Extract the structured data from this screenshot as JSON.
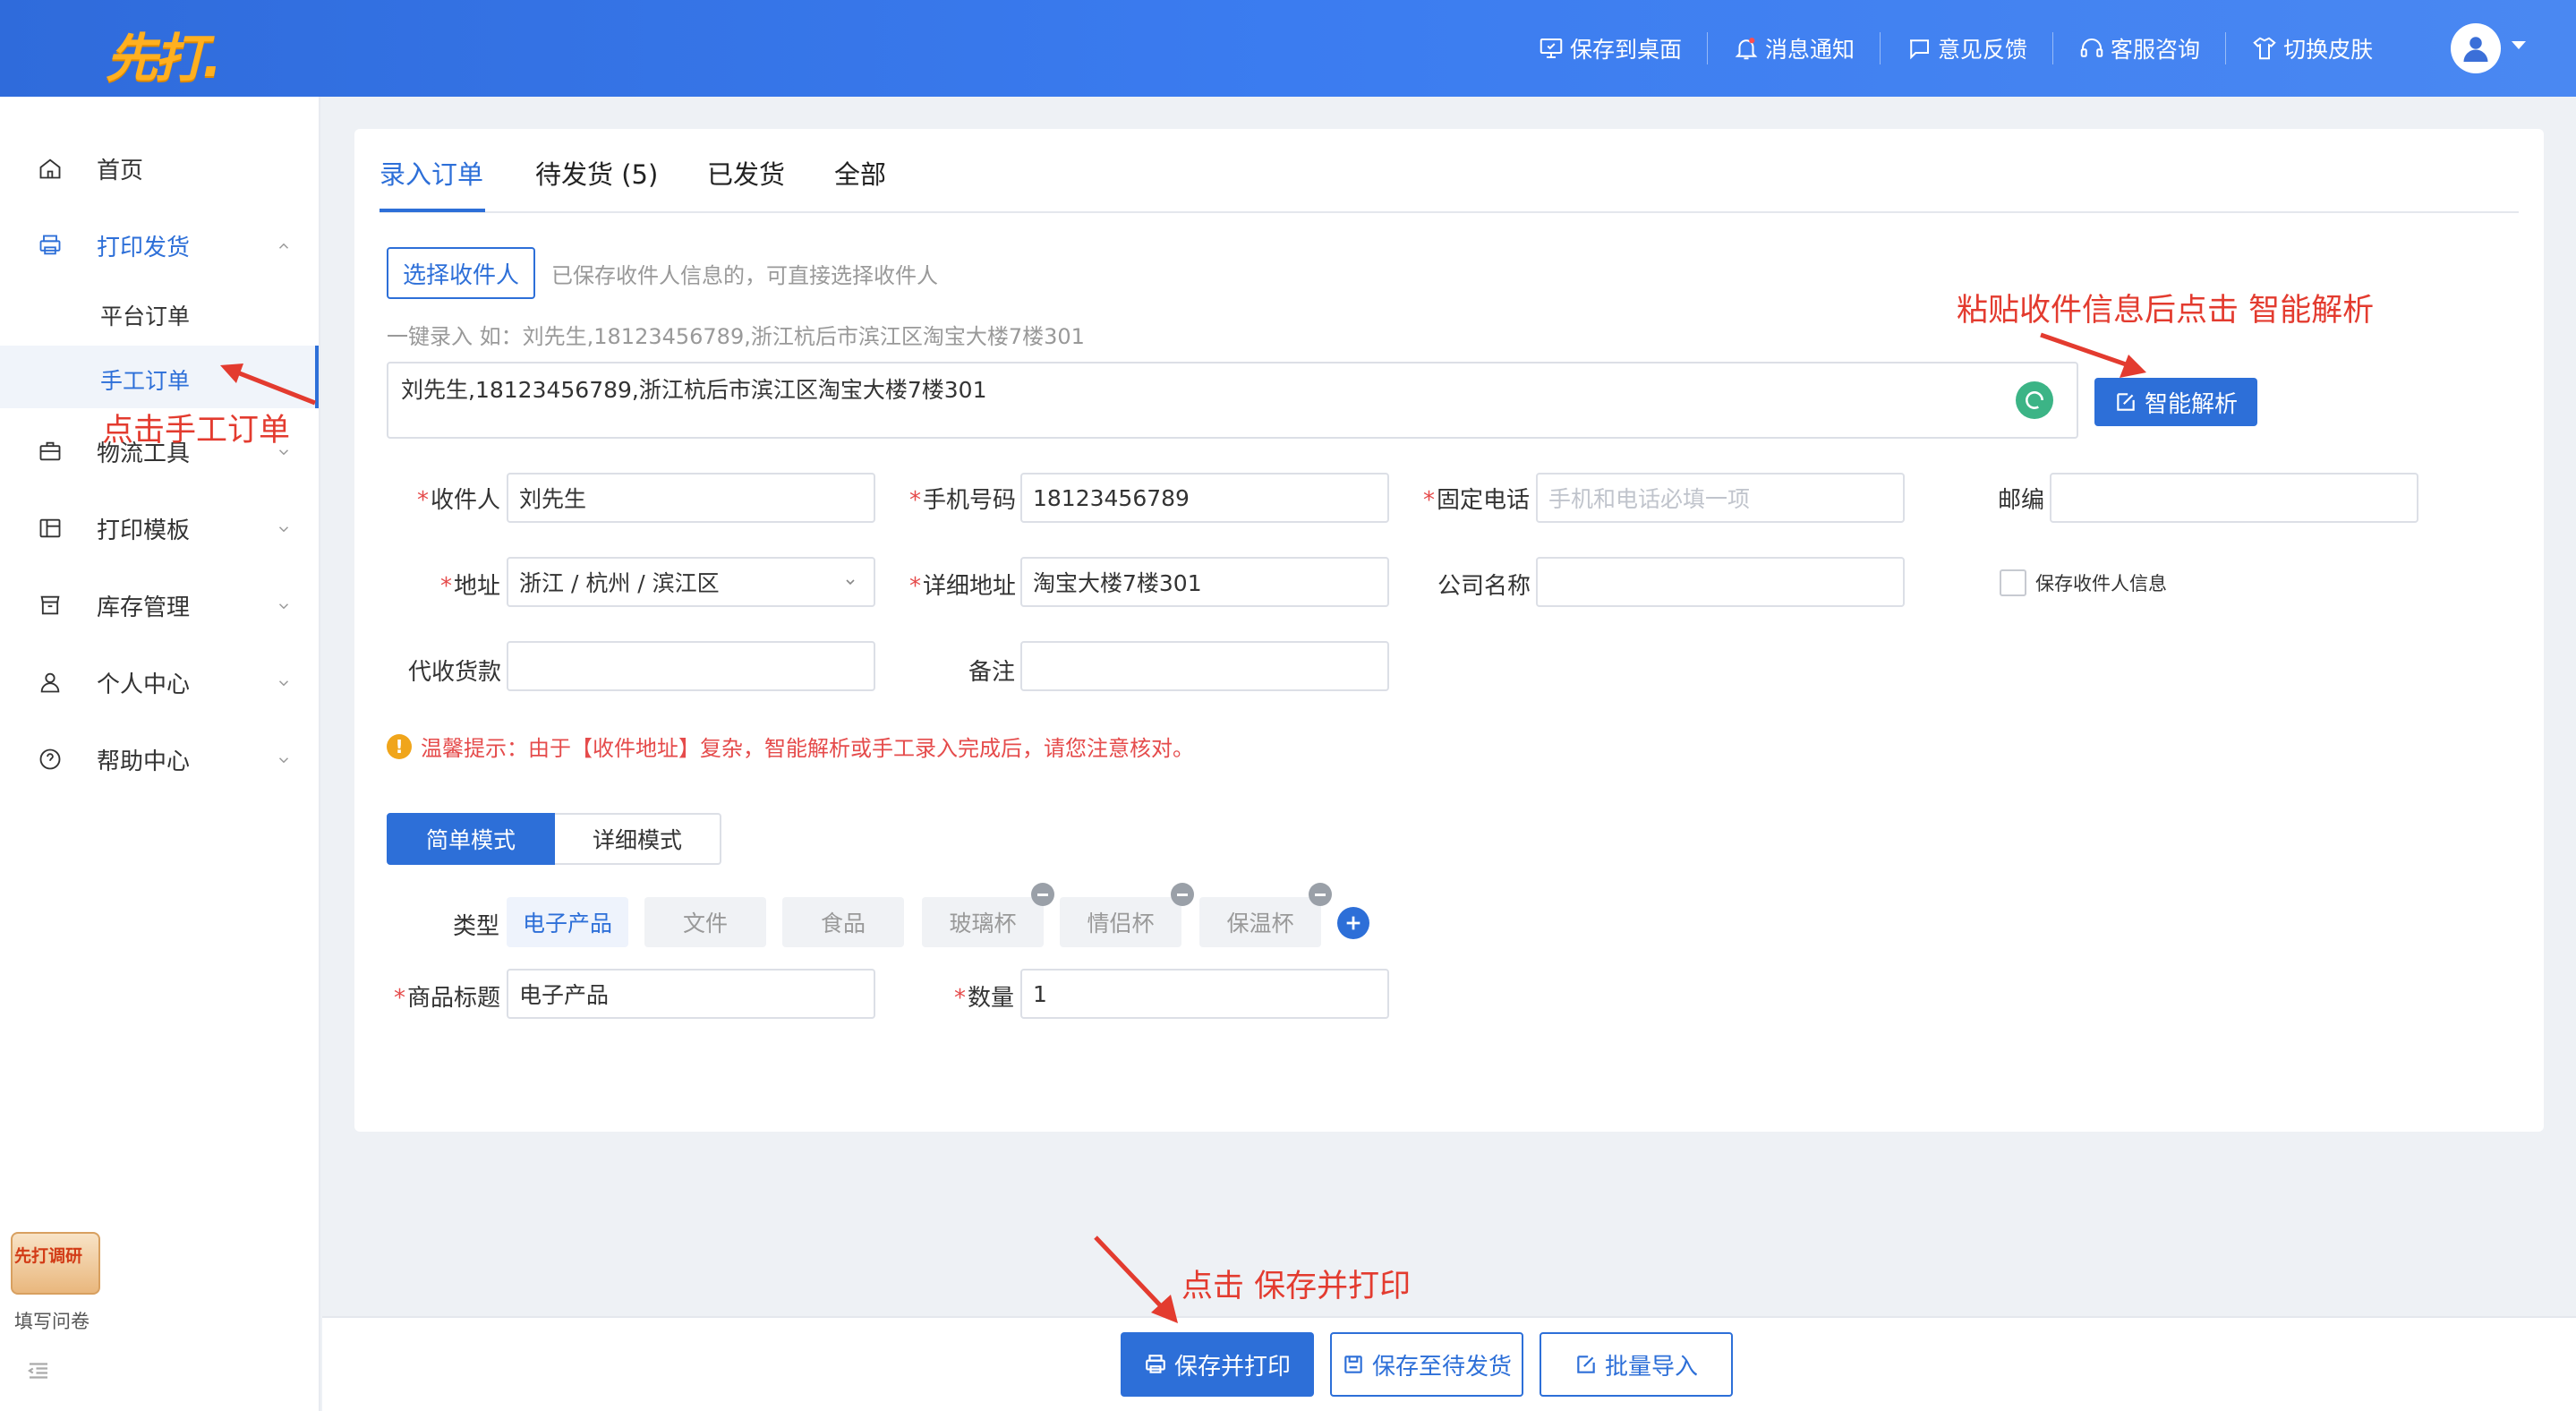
{
  "header": {
    "logo": "先打.",
    "nav": [
      "保存到桌面",
      "消息通知",
      "意见反馈",
      "客服咨询",
      "切换皮肤"
    ]
  },
  "sidebar": {
    "items": [
      {
        "label": "首页",
        "icon": "home-icon"
      },
      {
        "label": "打印发货",
        "icon": "printer-icon",
        "expanded": true
      },
      {
        "label": "物流工具",
        "icon": "briefcase-icon"
      },
      {
        "label": "打印模板",
        "icon": "template-icon"
      },
      {
        "label": "库存管理",
        "icon": "inventory-icon"
      },
      {
        "label": "个人中心",
        "icon": "user-icon"
      },
      {
        "label": "帮助中心",
        "icon": "help-icon"
      }
    ],
    "sub_items": [
      "平台订单",
      "手工订单"
    ],
    "survey_title": "先打调研",
    "survey_label": "填写问卷"
  },
  "tabs": [
    "录入订单",
    "待发货 (5)",
    "已发货",
    "全部"
  ],
  "form": {
    "select_recipient_btn": "选择收件人",
    "select_recipient_hint": "已保存收件人信息的，可直接选择收件人",
    "quick_entry_hint": "一键录入 如：刘先生,18123456789,浙江杭后市滨江区淘宝大楼7楼301",
    "quick_entry_value": "刘先生,18123456789,浙江杭后市滨江区淘宝大楼7楼301",
    "smart_parse_btn": "智能解析",
    "labels": {
      "recipient": "收件人",
      "mobile": "手机号码",
      "landline": "固定电话",
      "zipcode": "邮编",
      "address": "地址",
      "detail_address": "详细地址",
      "company": "公司名称",
      "save_recipient": "保存收件人信息",
      "cod": "代收货款",
      "remark": "备注",
      "type": "类型",
      "title": "商品标题",
      "quantity": "数量"
    },
    "values": {
      "recipient": "刘先生",
      "mobile": "18123456789",
      "landline_placeholder": "手机和电话必填一项",
      "address": "浙江 / 杭州 / 滨江区",
      "detail_address": "淘宝大楼7楼301",
      "title": "电子产品",
      "quantity": "1"
    },
    "warning": "温馨提示：由于【收件地址】复杂，智能解析或手工录入完成后，请您注意核对。",
    "modes": [
      "简单模式",
      "详细模式"
    ],
    "types": [
      "电子产品",
      "文件",
      "食品",
      "玻璃杯",
      "情侣杯",
      "保温杯"
    ]
  },
  "footer": {
    "save_print": "保存并打印",
    "save_pending": "保存至待发货",
    "batch_import": "批量导入"
  },
  "annotations": {
    "click_manual": "点击手工订单",
    "paste_parse": "粘贴收件信息后点击 智能解析",
    "click_save": "点击 保存并打印"
  },
  "colors": {
    "primary": "#2d6fd8",
    "header": "#3b7cf0",
    "annotation": "#e33b2f",
    "warning": "#f0a51b"
  }
}
